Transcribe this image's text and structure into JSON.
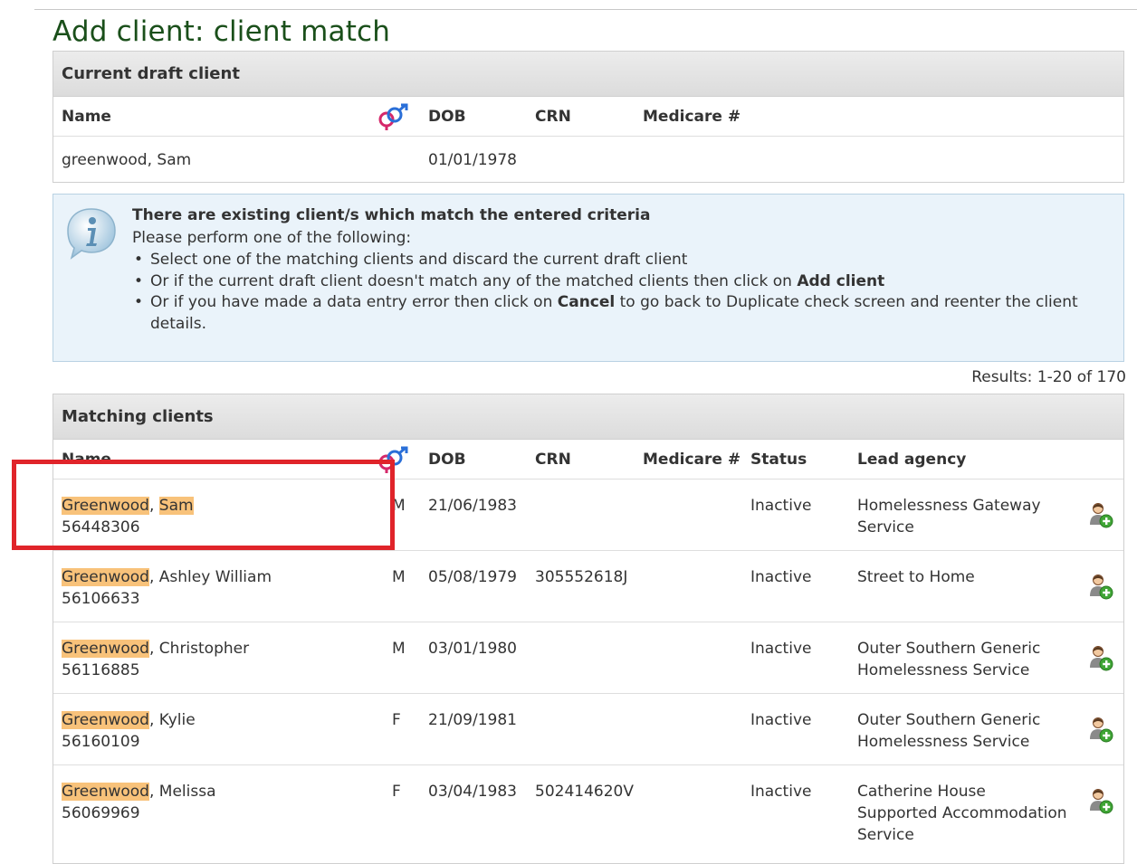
{
  "page_title": "Add client: client match",
  "draft_panel": {
    "title": "Current draft client",
    "columns": {
      "name": "Name",
      "dob": "DOB",
      "crn": "CRN",
      "medicare": "Medicare #"
    },
    "client": {
      "name": "greenwood, Sam",
      "dob": "01/01/1978"
    }
  },
  "info": {
    "title": "There are existing client/s which match the entered criteria",
    "subtitle": "Please perform one of the following:",
    "items": [
      {
        "text": "Select one of the matching clients and discard the current draft client"
      },
      {
        "before": "Or if the current draft client doesn't match any of the matched clients then click on ",
        "strong": "Add client"
      },
      {
        "before": "Or if you have made a data entry error then click on ",
        "strong": "Cancel",
        "after": " to go back to Duplicate check screen and reenter the client details."
      }
    ]
  },
  "results_text": "Results: 1-20 of 170",
  "matching_panel": {
    "title": "Matching clients",
    "columns": {
      "name": "Name",
      "dob": "DOB",
      "crn": "CRN",
      "medicare": "Medicare #",
      "status": "Status",
      "lead_agency": "Lead agency"
    },
    "rows": [
      {
        "surname": "Greenwood",
        "given": "Sam",
        "given_highlighted": true,
        "id": "56448306",
        "gender": "M",
        "dob": "21/06/1983",
        "crn": "",
        "medicare": "",
        "status": "Inactive",
        "agency": "Homelessness Gateway Service"
      },
      {
        "surname": "Greenwood",
        "given": "Ashley William",
        "given_highlighted": false,
        "id": "56106633",
        "gender": "M",
        "dob": "05/08/1979",
        "crn": "305552618J",
        "medicare": "",
        "status": "Inactive",
        "agency": "Street to Home"
      },
      {
        "surname": "Greenwood",
        "given": "Christopher",
        "given_highlighted": false,
        "id": "56116885",
        "gender": "M",
        "dob": "03/01/1980",
        "crn": "",
        "medicare": "",
        "status": "Inactive",
        "agency": "Outer Southern Generic Homelessness Service"
      },
      {
        "surname": "Greenwood",
        "given": "Kylie",
        "given_highlighted": false,
        "id": "56160109",
        "gender": "F",
        "dob": "21/09/1981",
        "crn": "",
        "medicare": "",
        "status": "Inactive",
        "agency": "Outer Southern Generic Homelessness Service"
      },
      {
        "surname": "Greenwood",
        "given": "Melissa",
        "given_highlighted": false,
        "id": "56069969",
        "gender": "F",
        "dob": "03/04/1983",
        "crn": "502414620V",
        "medicare": "",
        "status": "Inactive",
        "agency": "Catherine House Supported Accommodation Service"
      }
    ]
  },
  "icons": {
    "gender": "gender-symbol-icon",
    "info": "info-icon",
    "add": "add-client-icon"
  },
  "colors": {
    "title": "#1a4f1a",
    "highlight": "#f8c27a",
    "annotation": "#e0242a",
    "info_bg": "#eaf3fa"
  }
}
